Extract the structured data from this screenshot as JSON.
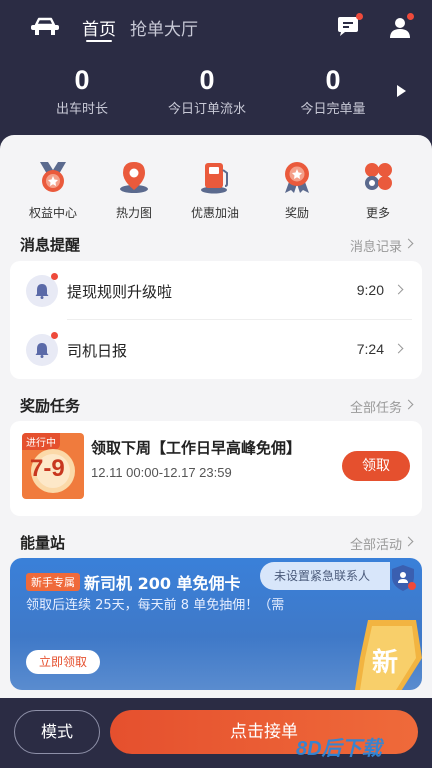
{
  "header": {
    "nav_home": "首页",
    "nav_grab": "抢单大厅",
    "stats": [
      {
        "value": "0",
        "label": "出车时长"
      },
      {
        "value": "0",
        "label": "今日订单流水"
      },
      {
        "value": "0",
        "label": "今日完单量"
      }
    ]
  },
  "quick_menu": [
    {
      "label": "权益中心",
      "icon": "medal-icon"
    },
    {
      "label": "热力图",
      "icon": "location-pin-icon"
    },
    {
      "label": "优惠加油",
      "icon": "gas-pump-icon"
    },
    {
      "label": "奖励",
      "icon": "reward-badge-icon"
    },
    {
      "label": "更多",
      "icon": "more-grid-icon"
    }
  ],
  "messages": {
    "title": "消息提醒",
    "more": "消息记录",
    "items": [
      {
        "text": "提现规则升级啦",
        "time": "9:20"
      },
      {
        "text": "司机日报",
        "time": "7:24"
      }
    ]
  },
  "tasks": {
    "title": "奖励任务",
    "more": "全部任务",
    "badge_tag": "进行中",
    "badge_num": "7-9",
    "task_title": "领取下周【工作日早高峰免佣】",
    "task_date": "12.11 00:00-12.17 23:59",
    "claim_label": "领取"
  },
  "energy": {
    "title": "能量站",
    "more": "全部活动",
    "banner_tag": "新手专属",
    "banner_title": "新司机 200 单免佣卡",
    "banner_desc": "领取后连续 25天，每天前 8 单免抽佣！（需",
    "banner_btn": "立即领取",
    "badge_text": "新",
    "emergency_text": "未设置紧急联系人"
  },
  "bottom": {
    "mode_label": "模式",
    "go_label": "点击接单"
  },
  "watermark": "8D后下载",
  "colors": {
    "header_bg": "#2b2c44",
    "accent": "#e5502e",
    "banner_blue": "#3a80d9"
  }
}
